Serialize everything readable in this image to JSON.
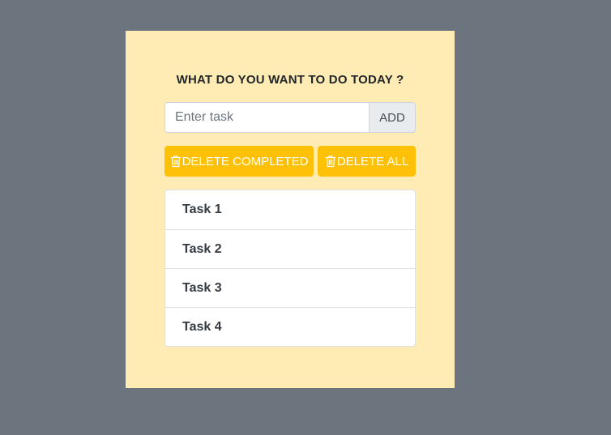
{
  "header": {
    "title": "WHAT DO YOU WANT TO DO TODAY ?"
  },
  "task_input": {
    "value": "",
    "placeholder": "Enter task"
  },
  "buttons": {
    "add_label": "ADD",
    "delete_completed_label": "DELETE COMPLETED",
    "delete_all_label": "DELETE ALL"
  },
  "tasks": [
    {
      "label": "Task 1"
    },
    {
      "label": "Task 2"
    },
    {
      "label": "Task 3"
    },
    {
      "label": "Task 4"
    }
  ],
  "colors": {
    "page_background": "#6c757d",
    "card_background": "#ffecb5",
    "accent": "#ffc107"
  },
  "icons": {
    "delete_icon": "trash-icon"
  }
}
